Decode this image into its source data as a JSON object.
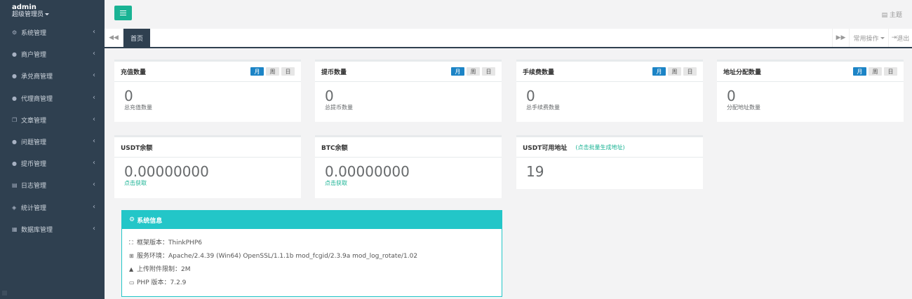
{
  "profile": {
    "name": "admin",
    "role": "超级管理员"
  },
  "sidebar": {
    "items": [
      {
        "label": "系统管理",
        "icon": "gear-icon",
        "glyph": "⚙"
      },
      {
        "label": "商户管理",
        "icon": "user-icon",
        "glyph": "●"
      },
      {
        "label": "承兑商管理",
        "icon": "user-icon",
        "glyph": "●"
      },
      {
        "label": "代理商管理",
        "icon": "user-icon",
        "glyph": "●"
      },
      {
        "label": "文章管理",
        "icon": "copy-icon",
        "glyph": "❐"
      },
      {
        "label": "问题管理",
        "icon": "comment-icon",
        "glyph": "●"
      },
      {
        "label": "提币管理",
        "icon": "user-icon",
        "glyph": "●"
      },
      {
        "label": "日志管理",
        "icon": "list-icon",
        "glyph": "▤"
      },
      {
        "label": "统计管理",
        "icon": "cube-icon",
        "glyph": "◈"
      },
      {
        "label": "数据库管理",
        "icon": "database-icon",
        "glyph": "▦"
      }
    ]
  },
  "topbar": {
    "theme_label": "主题"
  },
  "tabs": {
    "home": "首页",
    "common_ops": "常用操作",
    "logout": "退出"
  },
  "period": {
    "month": "月",
    "week": "周",
    "day": "日"
  },
  "stats": [
    {
      "title": "充值数量",
      "value": "0",
      "caption": "总充值数量"
    },
    {
      "title": "提币数量",
      "value": "0",
      "caption": "总提币数量"
    },
    {
      "title": "手续费数量",
      "value": "0",
      "caption": "总手续费数量"
    },
    {
      "title": "地址分配数量",
      "value": "0",
      "caption": "分配地址数量"
    }
  ],
  "balances": [
    {
      "title": "USDT余额",
      "value": "0.00000000",
      "link": "点击获取"
    },
    {
      "title": "BTC余额",
      "value": "0.00000000",
      "link": "点击获取"
    }
  ],
  "usdt_addr": {
    "title": "USDT可用地址",
    "link": "(点击批量生成地址)",
    "value": "19"
  },
  "sysinfo": {
    "title": "系统信息",
    "rows": [
      {
        "icon": "sitemap-icon",
        "glyph": "⛶",
        "text": "框架版本：ThinkPHP6"
      },
      {
        "icon": "windows-icon",
        "glyph": "⊞",
        "text": "服务环境：Apache/2.4.39 (Win64) OpenSSL/1.1.1b mod_fcgid/2.3.9a mod_log_rotate/1.02"
      },
      {
        "icon": "warning-icon",
        "glyph": "▲",
        "text": "上传附件限制：2M"
      },
      {
        "icon": "card-icon",
        "glyph": "▭",
        "text": "PHP 版本：7.2.9"
      }
    ]
  },
  "colors": {
    "sidebar": "#2f4050",
    "primary": "#1ab394",
    "info": "#23c6c8",
    "active_btn": "#1c84c6"
  }
}
